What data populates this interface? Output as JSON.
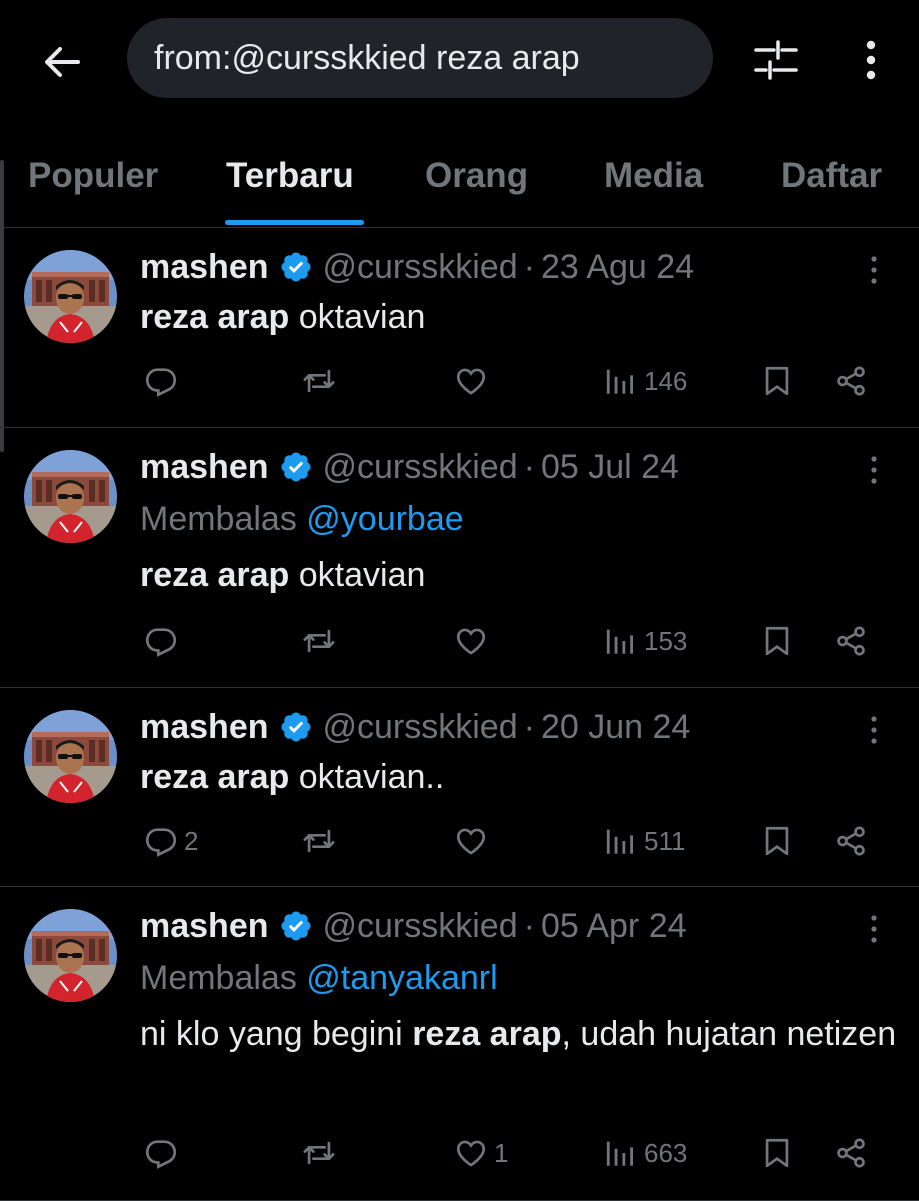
{
  "header": {
    "search_query": "from:@cursskkied reza arap"
  },
  "tabs": [
    {
      "label": "Populer",
      "active": false
    },
    {
      "label": "Terbaru",
      "active": true
    },
    {
      "label": "Orang",
      "active": false
    },
    {
      "label": "Media",
      "active": false
    },
    {
      "label": "Daftar",
      "active": false
    }
  ],
  "colors": {
    "accent": "#1d9bf0",
    "muted": "#71767b",
    "text": "#e7e9ea",
    "background": "#000000"
  },
  "tweets": [
    {
      "name": "mashen",
      "handle": "@cursskkied",
      "sep": "·",
      "date": "23 Agu 24",
      "reply_prefix": "",
      "reply_to": "",
      "text_bold": "reza arap",
      "text_after": " oktavian",
      "text_before": "",
      "replies": "",
      "likes": "",
      "views": "146"
    },
    {
      "name": "mashen",
      "handle": "@cursskkied",
      "sep": "·",
      "date": "05 Jul 24",
      "reply_prefix": "Membalas ",
      "reply_to": "@yourbae",
      "text_bold": "reza arap",
      "text_after": " oktavian",
      "text_before": "",
      "replies": "",
      "likes": "",
      "views": "153"
    },
    {
      "name": "mashen",
      "handle": "@cursskkied",
      "sep": "·",
      "date": "20 Jun 24",
      "reply_prefix": "",
      "reply_to": "",
      "text_bold": "reza arap",
      "text_after": " oktavian..",
      "text_before": "",
      "replies": "2",
      "likes": "",
      "views": "511"
    },
    {
      "name": "mashen",
      "handle": "@cursskkied",
      "sep": "·",
      "date": "05 Apr 24",
      "reply_prefix": "Membalas ",
      "reply_to": "@tanyakanrl",
      "text_before": "ni klo yang begini ",
      "text_bold": "reza arap",
      "text_after": ", udah hujatan netizen",
      "replies": "",
      "likes": "1",
      "views": "663"
    }
  ]
}
